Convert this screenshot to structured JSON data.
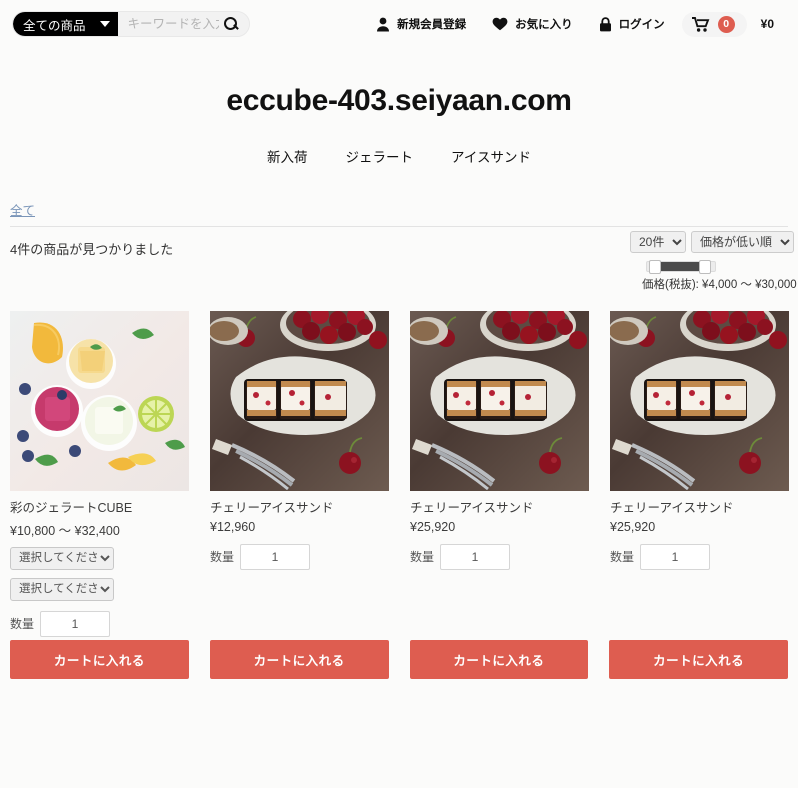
{
  "header": {
    "search_category": "全ての商品",
    "search_placeholder": "キーワードを入力",
    "search_value": "",
    "search_icon": "search-icon",
    "nav": [
      {
        "icon": "user-icon",
        "label": "新規会員登録"
      },
      {
        "icon": "heart-icon",
        "label": "お気に入り"
      },
      {
        "icon": "lock-icon",
        "label": "ログイン"
      }
    ],
    "cart": {
      "icon": "cart-icon",
      "count": "0",
      "total": "¥0"
    }
  },
  "site": {
    "title": "eccube-403.seiyaan.com",
    "nav": [
      {
        "label": "新入荷"
      },
      {
        "label": "ジェラート"
      },
      {
        "label": "アイスサンド"
      }
    ]
  },
  "listing": {
    "breadcrumb": "全て",
    "result_count": "4件の商品が見つかりました",
    "per_page": "20件",
    "sort": "価格が低い順",
    "price_filter_label": "価格(税抜): ¥4,000 〜 ¥30,000",
    "price_min": "¥4,000",
    "price_max": "¥30,000"
  },
  "products": [
    {
      "name": "彩のジェラートCUBE",
      "price": "¥10,800 〜 ¥32,400",
      "image": "gelato-cubes-photo",
      "options": [
        "選択してください",
        "選択してください"
      ],
      "qty_label": "数量",
      "qty_value": "1",
      "cart_label": "カートに入れる"
    },
    {
      "name": "チェリーアイスサンド",
      "price": "¥12,960",
      "image": "cherry-ice-sandwich-photo",
      "options": [],
      "qty_label": "数量",
      "qty_value": "1",
      "cart_label": "カートに入れる"
    },
    {
      "name": "チェリーアイスサンド",
      "price": "¥25,920",
      "image": "cherry-ice-sandwich-photo",
      "options": [],
      "qty_label": "数量",
      "qty_value": "1",
      "cart_label": "カートに入れる"
    },
    {
      "name": "チェリーアイスサンド",
      "price": "¥25,920",
      "image": "cherry-ice-sandwich-photo",
      "options": [],
      "qty_label": "数量",
      "qty_value": "1",
      "cart_label": "カートに入れる"
    }
  ],
  "colors": {
    "accent": "#DE5D50",
    "background": "#fbfbfa",
    "text": "#525263",
    "link": "#7a95b8"
  }
}
